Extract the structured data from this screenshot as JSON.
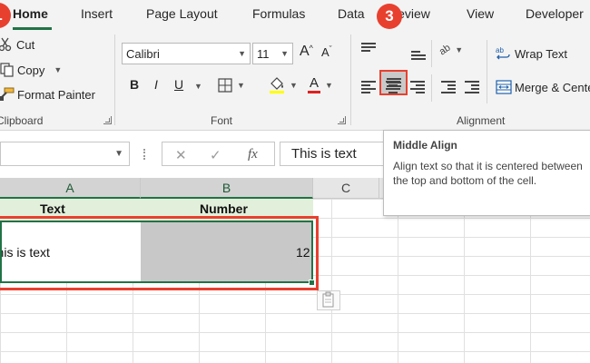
{
  "tabs": [
    "Home",
    "Insert",
    "Page Layout",
    "Formulas",
    "Data",
    "Review",
    "View",
    "Developer"
  ],
  "markers": {
    "left": "1",
    "step": "3"
  },
  "clipboard": {
    "cut": "Cut",
    "copy": "Copy",
    "format_painter": "Format Painter",
    "label": "Clipboard"
  },
  "font": {
    "name": "Calibri",
    "size": "11",
    "bold": "B",
    "italic": "I",
    "underline": "U",
    "grow": "A",
    "shrink": "A",
    "font_color_letter": "A",
    "label": "Font"
  },
  "alignment": {
    "wrap_text": "Wrap Text",
    "merge_center": "Merge & Center",
    "orientation_glyph": "ab",
    "label": "Alignment"
  },
  "formula_bar": {
    "fx": "fx",
    "value": "This is text"
  },
  "columns": [
    "A",
    "B",
    "C"
  ],
  "cells": {
    "a1": "Text",
    "b1": "Number",
    "a2": "This is text",
    "b2": "12"
  },
  "tooltip": {
    "title": "Middle Align",
    "body": "Align text so that it is centered between the top and bottom of the cell."
  },
  "colors": {
    "accent_green": "#217346",
    "highlight_red": "#e8402f",
    "header_fill": "#e2efda",
    "selected_cell_fill": "#c8c8c8"
  }
}
